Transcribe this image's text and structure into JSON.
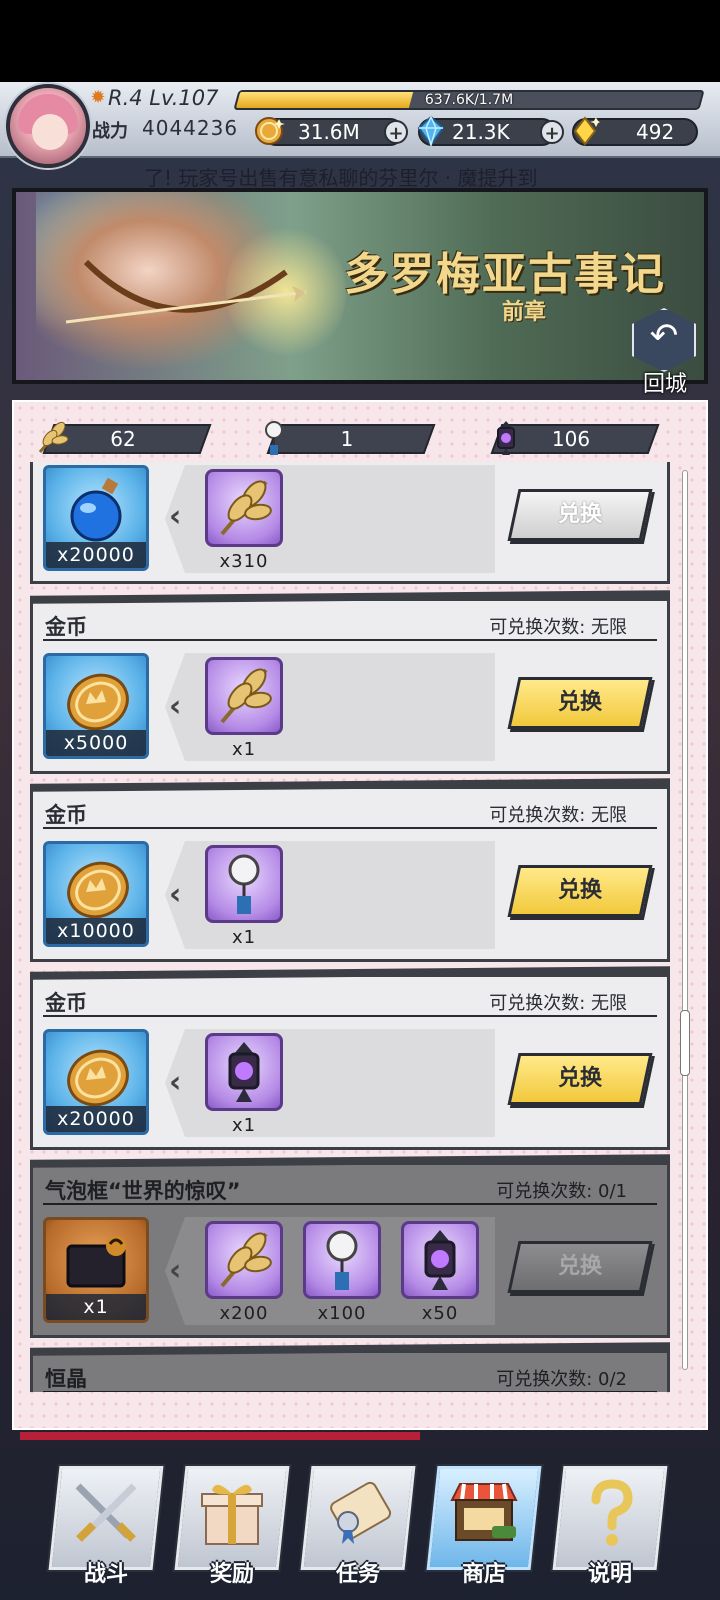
{
  "header": {
    "rank_level": "R.4 Lv.107",
    "exp_text": "637.6K/1.7M",
    "exp_fraction": 0.375,
    "power_label": "战力",
    "power_value": "4044236",
    "currencies": [
      {
        "name": "gold-coin",
        "value": "31.6M",
        "icon": "gold-coin-icon"
      },
      {
        "name": "blue-crystal",
        "value": "21.3K",
        "icon": "blue-crystal-icon"
      },
      {
        "name": "gold-gem",
        "value": "492",
        "icon": "gold-gem-icon"
      }
    ]
  },
  "ticker": {
    "text": "了!   玩家号出售有意私聊的芬里尔 · 魔提升到"
  },
  "banner": {
    "title": "多罗梅亚古事记",
    "subtitle": "前章",
    "back_label": "回城"
  },
  "tokens": [
    {
      "icon": "wheat-token-icon",
      "value": "62"
    },
    {
      "icon": "fan-charm-token-icon",
      "value": "1"
    },
    {
      "icon": "lantern-token-icon",
      "value": "106"
    }
  ],
  "shop": {
    "items": [
      {
        "title": "",
        "limit": "",
        "reward_icon": "blue-potion-icon",
        "reward_qty": "x20000",
        "costs": [
          {
            "icon": "wheat-token-icon",
            "qty": "x310"
          }
        ],
        "button_label": "兑换",
        "state": "disabled"
      },
      {
        "title": "金币",
        "limit": "可兑换次数: 无限",
        "reward_icon": "gold-coin-icon",
        "reward_qty": "x5000",
        "costs": [
          {
            "icon": "wheat-token-icon",
            "qty": "x1"
          }
        ],
        "button_label": "兑换",
        "state": "enabled"
      },
      {
        "title": "金币",
        "limit": "可兑换次数: 无限",
        "reward_icon": "gold-coin-icon",
        "reward_qty": "x10000",
        "costs": [
          {
            "icon": "fan-charm-token-icon",
            "qty": "x1"
          }
        ],
        "button_label": "兑换",
        "state": "enabled"
      },
      {
        "title": "金币",
        "limit": "可兑换次数: 无限",
        "reward_icon": "gold-coin-icon",
        "reward_qty": "x20000",
        "costs": [
          {
            "icon": "lantern-token-icon",
            "qty": "x1"
          }
        ],
        "button_label": "兑换",
        "state": "enabled"
      },
      {
        "title": "气泡框“世界的惊叹”",
        "limit": "可兑换次数: 0/1",
        "reward_icon": "speech-bubble-frame-icon",
        "reward_qty": "x1",
        "costs": [
          {
            "icon": "wheat-token-icon",
            "qty": "x200"
          },
          {
            "icon": "fan-charm-token-icon",
            "qty": "x100"
          },
          {
            "icon": "lantern-token-icon",
            "qty": "x50"
          }
        ],
        "button_label": "兑换",
        "state": "sold-out"
      },
      {
        "title": "恒晶",
        "limit": "可兑换次数: 0/2",
        "state": "sold-out"
      }
    ]
  },
  "nav": [
    {
      "label": "战斗",
      "icon": "crossed-swords-icon",
      "active": false
    },
    {
      "label": "奖励",
      "icon": "gift-box-icon",
      "active": false
    },
    {
      "label": "任务",
      "icon": "scroll-quest-icon",
      "active": false
    },
    {
      "label": "商店",
      "icon": "shop-stall-icon",
      "active": true
    },
    {
      "label": "说明",
      "icon": "question-mark-icon",
      "active": false
    }
  ]
}
